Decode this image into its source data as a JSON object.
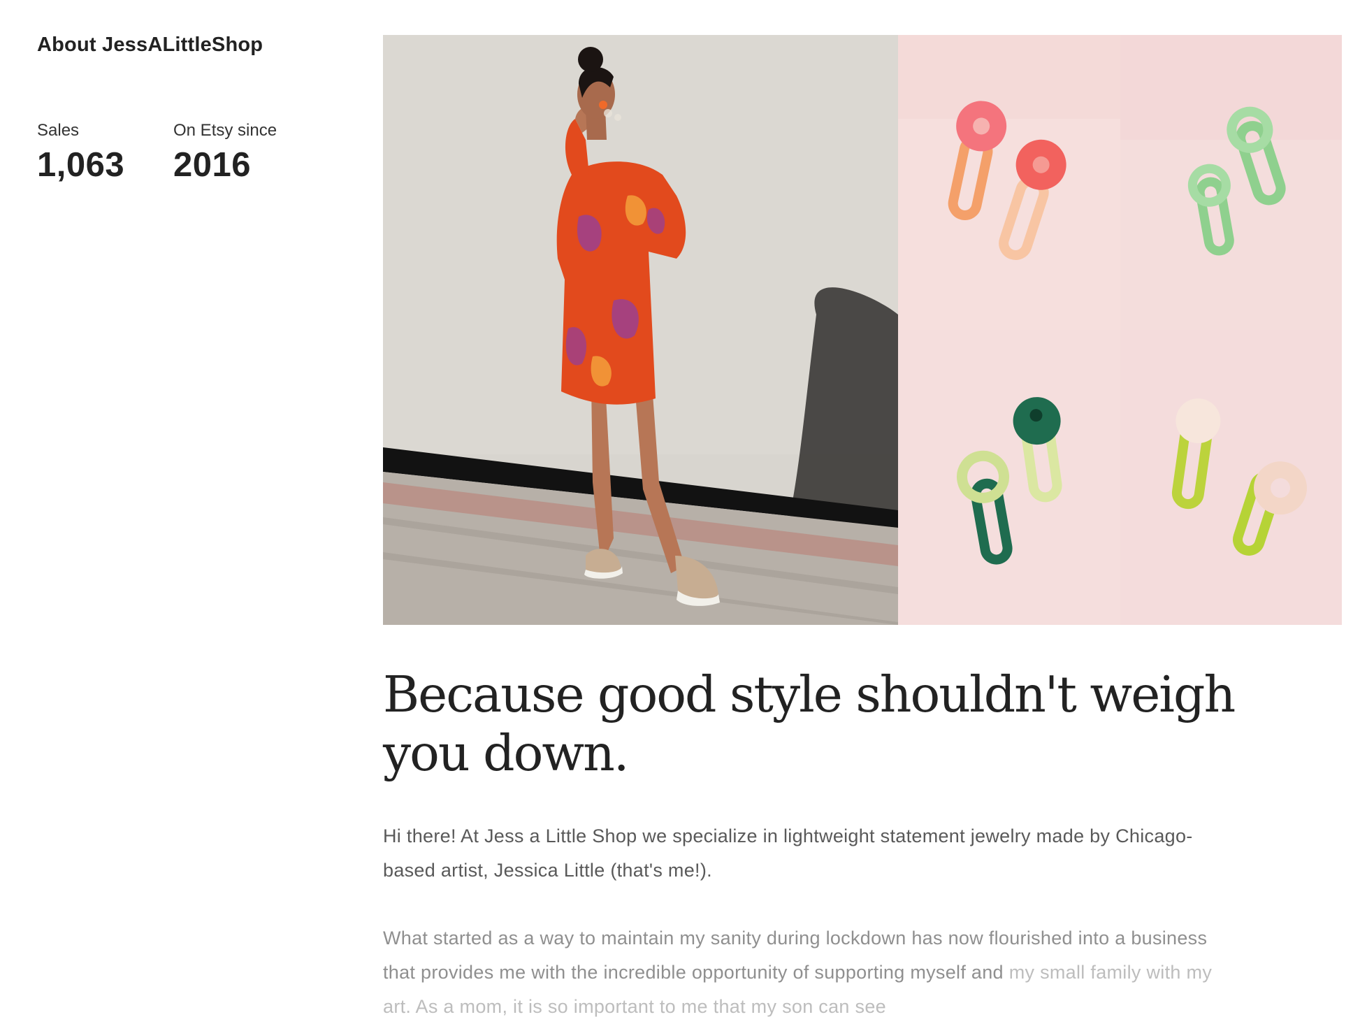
{
  "about": {
    "title": "About JessALittleShop"
  },
  "stats": {
    "sales_label": "Sales",
    "sales_value": "1,063",
    "since_label": "On Etsy since",
    "since_value": "2016"
  },
  "gallery": {
    "main_photo": "woman-in-orange-floral-dress-photo",
    "tiles": [
      "pink-orange-earrings-photo",
      "green-earrings-photo",
      "green-lime-earrings-photo",
      "lime-pink-earrings-photo"
    ]
  },
  "story": {
    "headline": "Because good style shouldn't weigh you down.",
    "paragraph_1": "Hi there! At Jess a Little Shop we specialize in lightweight statement jewelry made by Chicago-based artist, Jessica Little (that's me!).",
    "paragraph_2": "What started as a way to maintain my sanity during lockdown has now flourished into a business that provides me with the incredible opportunity of supporting myself and",
    "paragraph_2_cut": "my small family with my art. As a mom, it is so important to me that my son can see"
  }
}
